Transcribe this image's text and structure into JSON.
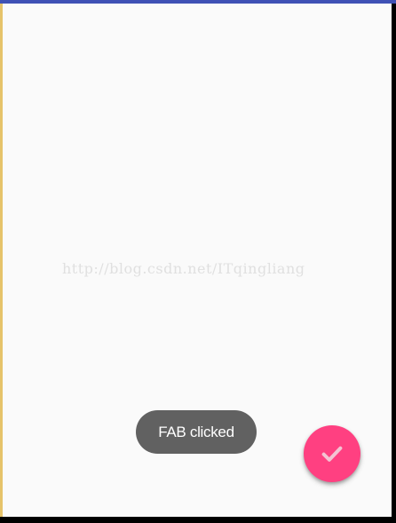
{
  "colors": {
    "primary": "#3f51b5",
    "accent": "#ff4081",
    "background": "#fafafa",
    "toast_background": "#616161"
  },
  "watermark": {
    "text": "http://blog.csdn.net/ITqingliang"
  },
  "toast": {
    "message": "FAB clicked"
  },
  "fab": {
    "icon": "check-icon"
  }
}
